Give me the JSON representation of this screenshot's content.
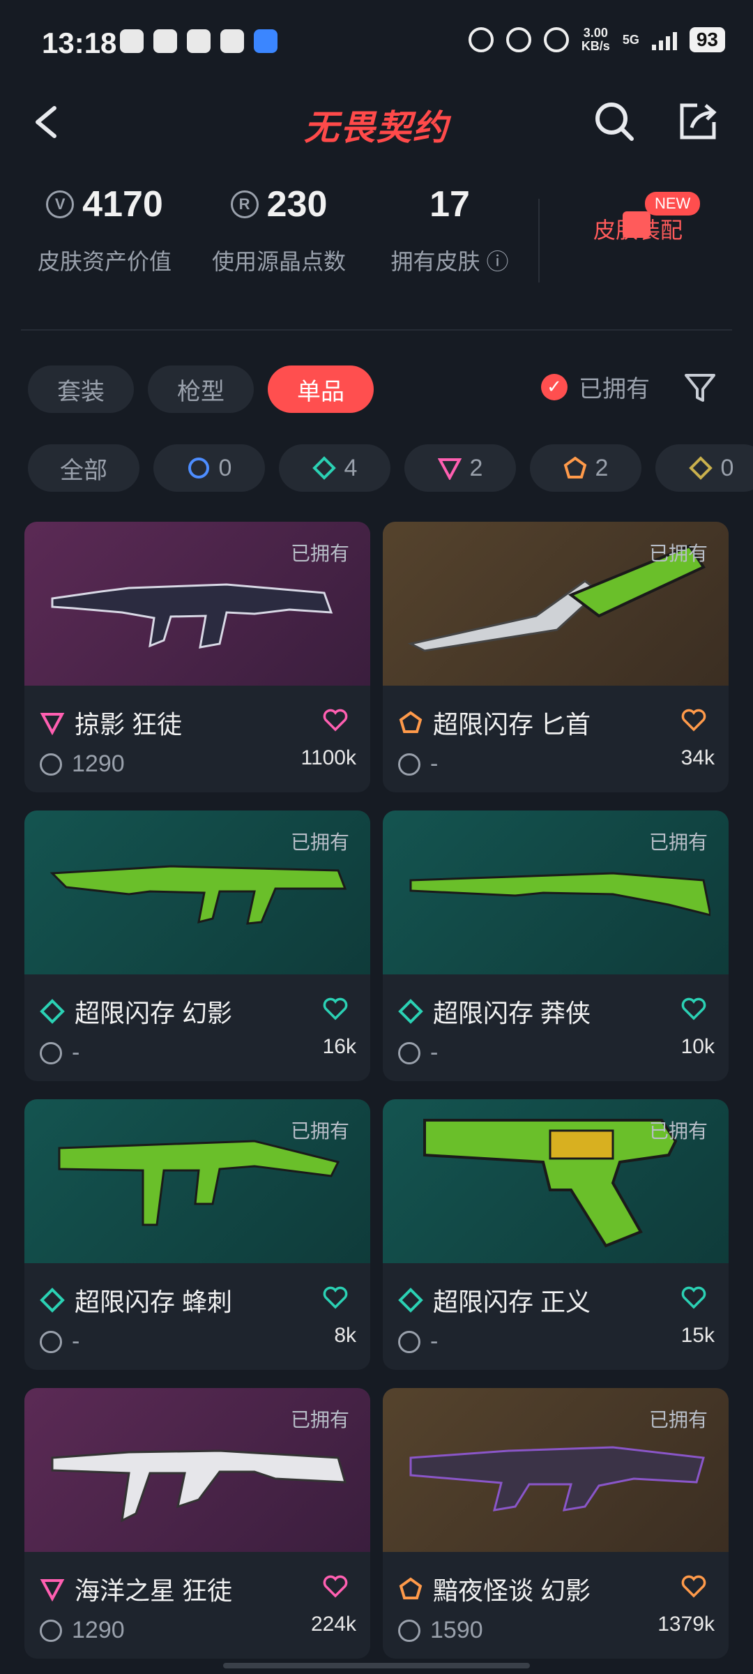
{
  "status_bar": {
    "time": "13:18",
    "speed_top": "3.00",
    "speed_bottom": "KB/s",
    "network": "5G",
    "battery": "93"
  },
  "header": {
    "title": "无畏契约"
  },
  "stats": {
    "asset_value": "4170",
    "asset_label": "皮肤资产价值",
    "radianite_points": "230",
    "radianite_label": "使用源晶点数",
    "owned_count": "17",
    "owned_label": "拥有皮肤 ⓘ",
    "loadout_label": "皮肤装配",
    "new_badge": "NEW"
  },
  "tabs": [
    "套装",
    "枪型",
    "单品"
  ],
  "owned_filter_label": "已拥有",
  "tier_chips": [
    {
      "label": "全部",
      "count": ""
    },
    {
      "label": "",
      "count": "0",
      "color": "#4d8dff"
    },
    {
      "label": "",
      "count": "4",
      "color": "#2bd1b4"
    },
    {
      "label": "",
      "count": "2",
      "color": "#ff5fb1"
    },
    {
      "label": "",
      "count": "2",
      "color": "#ff9a4a"
    },
    {
      "label": "",
      "count": "0",
      "color": "#c9b04d"
    }
  ],
  "cards": [
    {
      "name": "掠影 狂徒",
      "price": "1290",
      "likes": "1100k",
      "owned": "已拥有",
      "tier_color": "#ff5fb1",
      "bg": "purple"
    },
    {
      "name": "超限闪存 匕首",
      "price": "-",
      "likes": "34k",
      "owned": "已拥有",
      "tier_color": "#ff9a4a",
      "bg": "orange"
    },
    {
      "name": "超限闪存 幻影",
      "price": "-",
      "likes": "16k",
      "owned": "已拥有",
      "tier_color": "#2bd1b4",
      "bg": "teal"
    },
    {
      "name": "超限闪存 莽侠",
      "price": "-",
      "likes": "10k",
      "owned": "已拥有",
      "tier_color": "#2bd1b4",
      "bg": "teal"
    },
    {
      "name": "超限闪存 蜂刺",
      "price": "-",
      "likes": "8k",
      "owned": "已拥有",
      "tier_color": "#2bd1b4",
      "bg": "teal"
    },
    {
      "name": "超限闪存 正义",
      "price": "-",
      "likes": "15k",
      "owned": "已拥有",
      "tier_color": "#2bd1b4",
      "bg": "teal"
    },
    {
      "name": "海洋之星 狂徒",
      "price": "1290",
      "likes": "224k",
      "owned": "已拥有",
      "tier_color": "#ff5fb1",
      "bg": "purple"
    },
    {
      "name": "黯夜怪谈 幻影",
      "price": "1590",
      "likes": "1379k",
      "owned": "已拥有",
      "tier_color": "#ff9a4a",
      "bg": "orange"
    }
  ]
}
